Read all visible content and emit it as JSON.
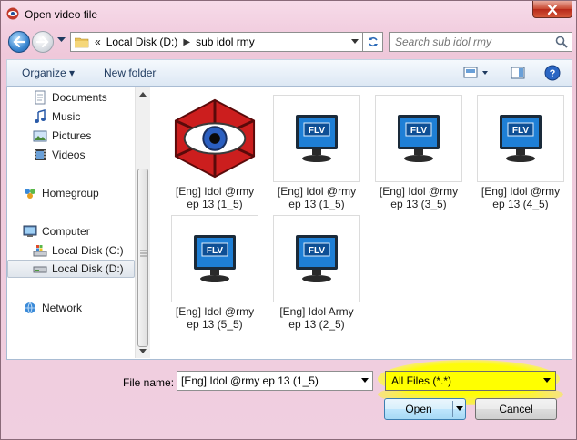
{
  "window": {
    "title": "Open video file",
    "icon": "media-player-eye-icon"
  },
  "nav": {
    "breadcrumb": {
      "overflow": "«",
      "segments": [
        "Local Disk (D:)",
        "sub idol rmy"
      ]
    },
    "search_placeholder": "Search sub idol rmy"
  },
  "toolbar": {
    "organize_label": "Organize ▾",
    "new_folder_label": "New folder"
  },
  "sidebar": {
    "items": [
      {
        "label": "Documents",
        "icon": "documents-icon"
      },
      {
        "label": "Music",
        "icon": "music-icon"
      },
      {
        "label": "Pictures",
        "icon": "pictures-icon"
      },
      {
        "label": "Videos",
        "icon": "videos-icon"
      },
      {
        "label": "Homegroup",
        "icon": "homegroup-icon"
      },
      {
        "label": "Computer",
        "icon": "computer-icon"
      },
      {
        "label": "Local Disk (C:)",
        "icon": "drive-windows-icon"
      },
      {
        "label": "Local Disk (D:)",
        "icon": "drive-icon",
        "selected": true
      },
      {
        "label": "Network",
        "icon": "network-icon"
      }
    ]
  },
  "files": [
    {
      "line1": "[Eng] Idol @rmy",
      "line2": "ep 13 (1_5)",
      "icon": "aegisub-eye-icon"
    },
    {
      "line1": "[Eng] Idol @rmy",
      "line2": "ep 13 (1_5)",
      "icon": "flv-file-icon",
      "badge": "FLV"
    },
    {
      "line1": "[Eng] Idol @rmy",
      "line2": "ep 13 (3_5)",
      "icon": "flv-file-icon",
      "badge": "FLV"
    },
    {
      "line1": "[Eng] Idol @rmy",
      "line2": "ep 13 (4_5)",
      "icon": "flv-file-icon",
      "badge": "FLV"
    },
    {
      "line1": "[Eng] Idol @rmy",
      "line2": "ep 13 (5_5)",
      "icon": "flv-file-icon",
      "badge": "FLV"
    },
    {
      "line1": "[Eng] Idol Army",
      "line2": "ep 13 (2_5)",
      "icon": "flv-file-icon",
      "badge": "FLV"
    }
  ],
  "footer": {
    "filename_label": "File name:",
    "filename_value": "[Eng] Idol @rmy ep 13 (1_5)",
    "filter_value": "All Files (*.*)",
    "open_label": "Open",
    "cancel_label": "Cancel"
  },
  "colors": {
    "highlight": "#ffff00",
    "title_bar": "#f2cfe0",
    "flv_screen": "#1e7fd6"
  }
}
